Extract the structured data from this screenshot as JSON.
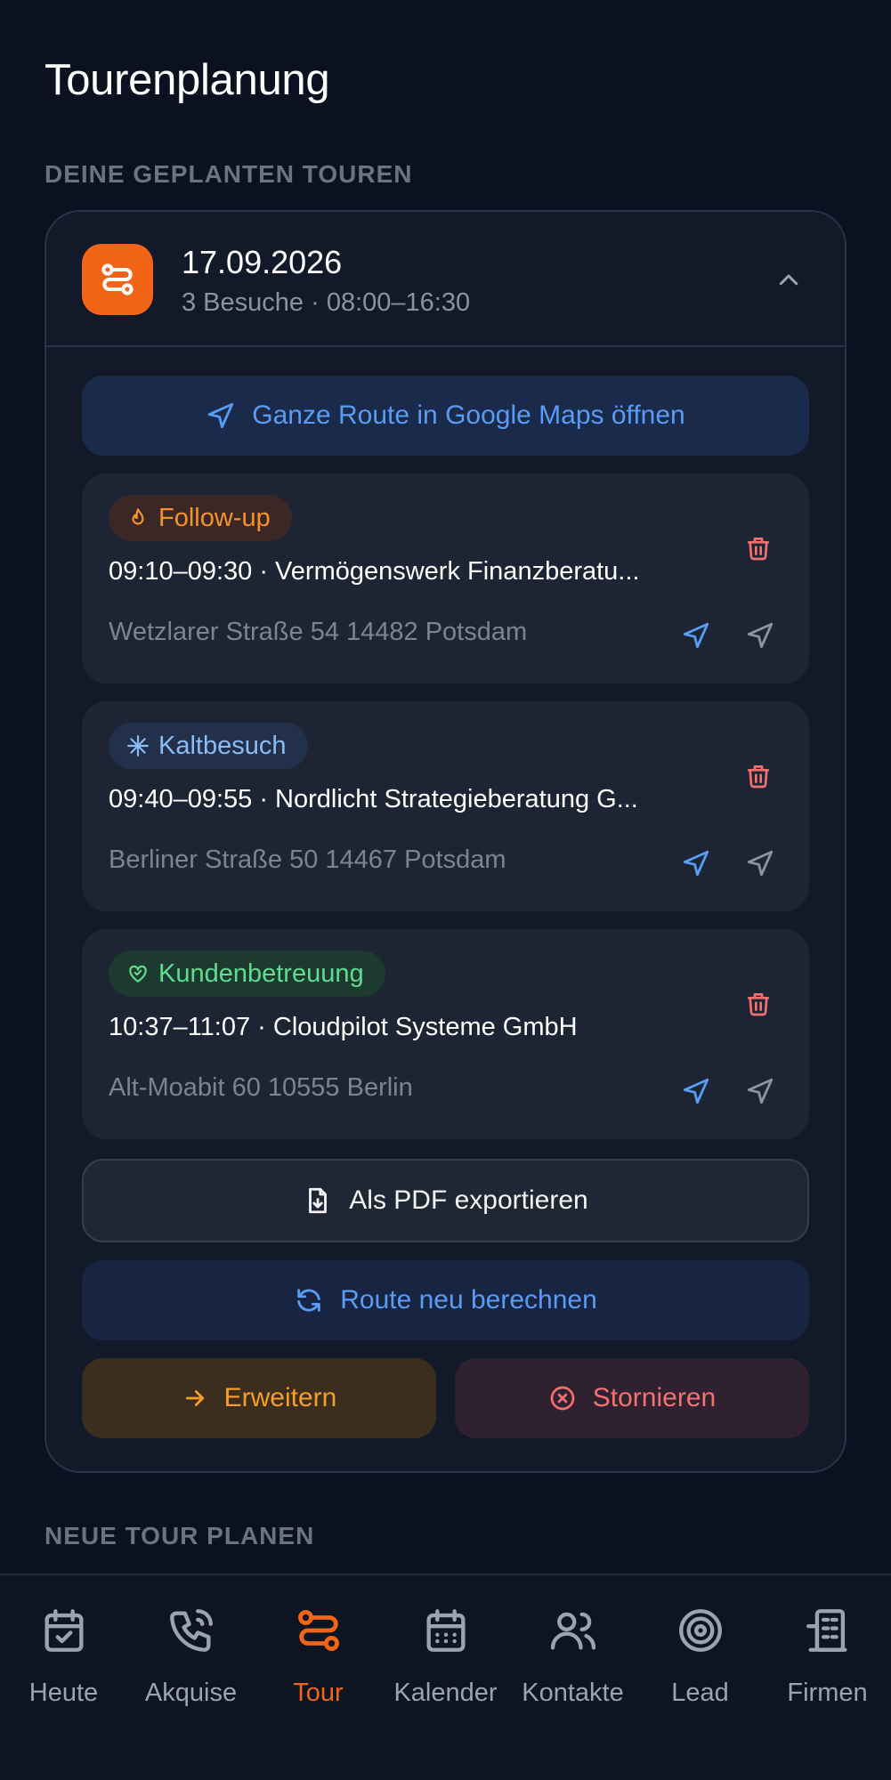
{
  "page": {
    "title": "Tourenplanung"
  },
  "sections": {
    "planned_label": "DEINE GEPLANTEN TOUREN",
    "new_label": "NEUE TOUR PLANEN"
  },
  "tour": {
    "date": "17.09.2026",
    "meta": "3 Besuche · 08:00–16:30",
    "maps_button": "Ganze Route in Google Maps öffnen",
    "pdf_button": "Als PDF exportieren",
    "recalc_button": "Route neu berechnen",
    "extend_button": "Erweitern",
    "cancel_button": "Stornieren",
    "visits": [
      {
        "badge": "Follow-up",
        "title": "09:10–09:30 · Vermögenswerk Finanzberatu...",
        "address": "Wetzlarer Straße 54 14482 Potsdam"
      },
      {
        "badge": "Kaltbesuch",
        "title": "09:40–09:55 · Nordlicht Strategieberatung G...",
        "address": "Berliner Straße 50 14467 Potsdam"
      },
      {
        "badge": "Kundenbetreuung",
        "title": "10:37–11:07 · Cloudpilot Systeme GmbH",
        "address": "Alt-Moabit 60 10555 Berlin"
      }
    ]
  },
  "bottom_nav": {
    "items": [
      {
        "label": "Heute",
        "icon": "calendar-check-icon"
      },
      {
        "label": "Akquise",
        "icon": "phone-call-icon"
      },
      {
        "label": "Tour",
        "icon": "route-icon",
        "active": true
      },
      {
        "label": "Kalender",
        "icon": "calendar-grid-icon"
      },
      {
        "label": "Kontakte",
        "icon": "users-icon"
      },
      {
        "label": "Lead",
        "icon": "target-icon"
      },
      {
        "label": "Firmen",
        "icon": "building-icon"
      }
    ]
  },
  "colors": {
    "accent": "#f26418",
    "link_blue": "#5a9bf4",
    "danger": "#f27171",
    "background": "#0b1120"
  }
}
